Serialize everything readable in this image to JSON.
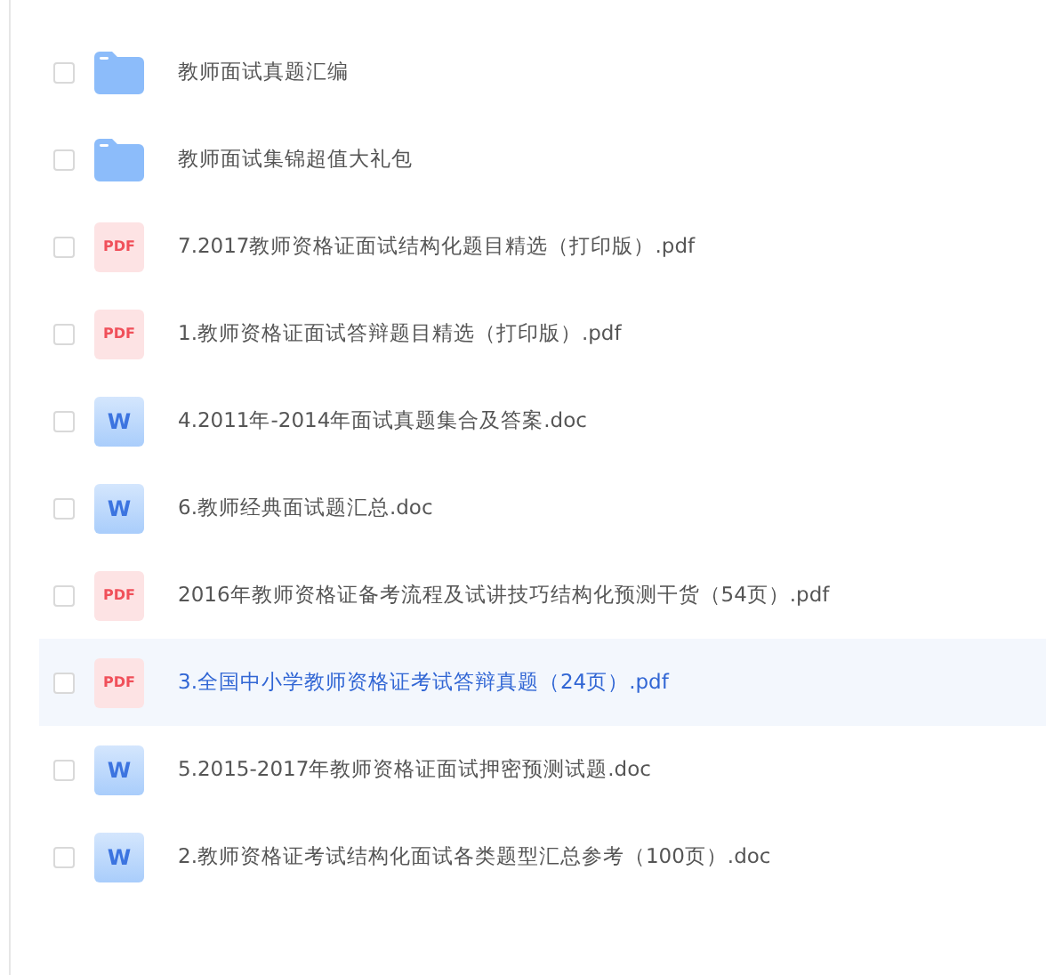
{
  "files": [
    {
      "kind": "folder",
      "name": "教师面试真题汇编",
      "checked": false,
      "selected": false
    },
    {
      "kind": "folder",
      "name": "教师面试集锦超值大礼包",
      "checked": false,
      "selected": false
    },
    {
      "kind": "pdf",
      "badge": "PDF",
      "name": "7.2017教师资格证面试结构化题目精选（打印版）.pdf",
      "checked": false,
      "selected": false
    },
    {
      "kind": "pdf",
      "badge": "PDF",
      "name": "1.教师资格证面试答辩题目精选（打印版）.pdf",
      "checked": false,
      "selected": false
    },
    {
      "kind": "word",
      "badge": "W",
      "name": "4.2011年-2014年面试真题集合及答案.doc",
      "checked": false,
      "selected": false
    },
    {
      "kind": "word",
      "badge": "W",
      "name": "6.教师经典面试题汇总.doc",
      "checked": false,
      "selected": false
    },
    {
      "kind": "pdf",
      "badge": "PDF",
      "name": "2016年教师资格证备考流程及试讲技巧结构化预测干货（54页）.pdf",
      "checked": false,
      "selected": false
    },
    {
      "kind": "pdf",
      "badge": "PDF",
      "name": "3.全国中小学教师资格证考试答辩真题（24页）.pdf",
      "checked": false,
      "selected": true
    },
    {
      "kind": "word",
      "badge": "W",
      "name": "5.2015-2017年教师资格证面试押密预测试题.doc",
      "checked": false,
      "selected": false
    },
    {
      "kind": "word",
      "badge": "W",
      "name": "2.教师资格证考试结构化面试各类题型汇总参考（100页）.doc",
      "checked": false,
      "selected": false
    }
  ]
}
